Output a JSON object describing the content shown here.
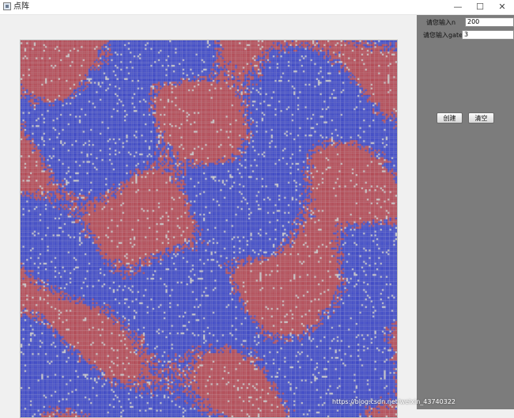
{
  "window": {
    "title": "点阵",
    "icon": "java-app-icon",
    "controls": {
      "minimize": "—",
      "maximize": "☐",
      "close": "✕"
    }
  },
  "grid": {
    "n": 200,
    "colors": {
      "red": "#b34a55",
      "blue": "#3e49c6",
      "empty": "#c9c9c9"
    }
  },
  "panel": {
    "label_n": "请您输入n",
    "value_n": "200",
    "label_gate": "请您输入gate",
    "value_gate": "3",
    "create_button": "创建",
    "clear_button": "清空"
  },
  "watermark": "https://blog.csdn.net/weixin_43740322"
}
